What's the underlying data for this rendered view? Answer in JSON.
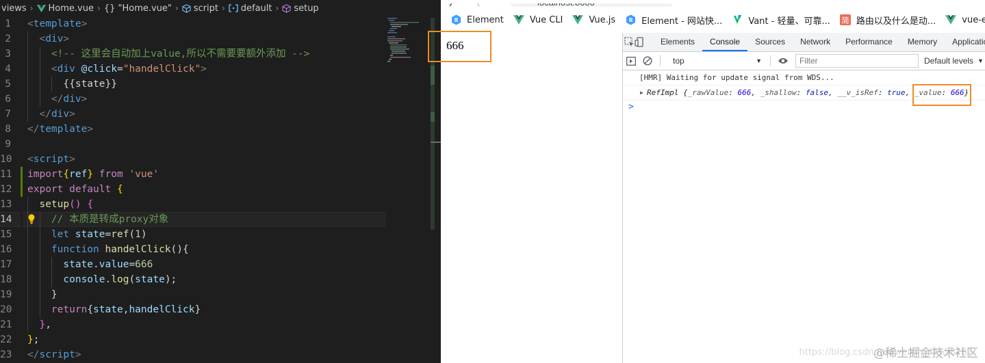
{
  "editor": {
    "breadcrumb": [
      "views",
      "Home.vue",
      "{} \"Home.vue\"",
      "script",
      "default",
      "setup"
    ],
    "lines": [
      {
        "n": "1",
        "tokens": [
          [
            "<",
            "t-punc"
          ],
          [
            "template",
            "t-tag"
          ],
          [
            ">",
            "t-punc"
          ]
        ]
      },
      {
        "n": "2",
        "tokens": [
          [
            "  ",
            ""
          ],
          [
            "<",
            "t-punc"
          ],
          [
            "div",
            "t-tag"
          ],
          [
            ">",
            "t-punc"
          ]
        ]
      },
      {
        "n": "3",
        "tokens": [
          [
            "    ",
            ""
          ],
          [
            "<!-- 这里会自动加上value,所以不需要要额外添加 -->",
            "t-com"
          ]
        ]
      },
      {
        "n": "4",
        "tokens": [
          [
            "    ",
            ""
          ],
          [
            "<",
            "t-punc"
          ],
          [
            "div",
            "t-tag"
          ],
          [
            " ",
            ""
          ],
          [
            "@click",
            "t-attr"
          ],
          [
            "=",
            "t-white"
          ],
          [
            "\"handelClick\"",
            "t-str"
          ],
          [
            ">",
            "t-punc"
          ]
        ]
      },
      {
        "n": "5",
        "tokens": [
          [
            "      ",
            ""
          ],
          [
            "{{state}}",
            "t-white"
          ]
        ]
      },
      {
        "n": "6",
        "tokens": [
          [
            "    ",
            ""
          ],
          [
            "</",
            "t-punc"
          ],
          [
            "div",
            "t-tag"
          ],
          [
            ">",
            "t-punc"
          ]
        ]
      },
      {
        "n": "7",
        "tokens": [
          [
            "  ",
            ""
          ],
          [
            "</",
            "t-punc"
          ],
          [
            "div",
            "t-tag"
          ],
          [
            ">",
            "t-punc"
          ]
        ]
      },
      {
        "n": "8",
        "tokens": [
          [
            "</",
            "t-punc"
          ],
          [
            "template",
            "t-tag"
          ],
          [
            ">",
            "t-punc"
          ]
        ]
      },
      {
        "n": "9",
        "tokens": []
      },
      {
        "n": "10",
        "tokens": [
          [
            "<",
            "t-punc"
          ],
          [
            "script",
            "t-tag"
          ],
          [
            ">",
            "t-punc"
          ]
        ]
      },
      {
        "n": "11",
        "tokens": [
          [
            "import",
            "t-kw"
          ],
          [
            "{",
            "t-br1"
          ],
          [
            "ref",
            "t-var"
          ],
          [
            "}",
            "t-br1"
          ],
          [
            " from ",
            "t-kw"
          ],
          [
            "'vue'",
            "t-str"
          ]
        ]
      },
      {
        "n": "12",
        "tokens": [
          [
            "export default ",
            "t-kw"
          ],
          [
            "{",
            "t-br1"
          ]
        ]
      },
      {
        "n": "13",
        "tokens": [
          [
            "  ",
            ""
          ],
          [
            "setup",
            "t-fn"
          ],
          [
            "()",
            "t-br2"
          ],
          [
            " ",
            ""
          ],
          [
            "{",
            "t-br2"
          ]
        ]
      },
      {
        "n": "14",
        "tokens": [
          [
            "    ",
            ""
          ],
          [
            "// 本质是转成proxy对象",
            "t-com"
          ]
        ]
      },
      {
        "n": "15",
        "tokens": [
          [
            "    ",
            ""
          ],
          [
            "let ",
            "t-blue"
          ],
          [
            "state",
            "t-var"
          ],
          [
            "=",
            "t-white"
          ],
          [
            "ref",
            "t-fn"
          ],
          [
            "(",
            "t-white"
          ],
          [
            "1",
            "t-num"
          ],
          [
            ")",
            "t-white"
          ]
        ]
      },
      {
        "n": "16",
        "tokens": [
          [
            "    ",
            ""
          ],
          [
            "function ",
            "t-blue"
          ],
          [
            "handelClick",
            "t-fn"
          ],
          [
            "(){",
            "t-white"
          ]
        ]
      },
      {
        "n": "17",
        "tokens": [
          [
            "      ",
            ""
          ],
          [
            "state",
            "t-var"
          ],
          [
            ".",
            "t-white"
          ],
          [
            "value",
            "t-var"
          ],
          [
            "=",
            "t-white"
          ],
          [
            "666",
            "t-num"
          ]
        ]
      },
      {
        "n": "18",
        "tokens": [
          [
            "      ",
            ""
          ],
          [
            "console",
            "t-var"
          ],
          [
            ".",
            "t-white"
          ],
          [
            "log",
            "t-fn"
          ],
          [
            "(",
            "t-white"
          ],
          [
            "state",
            "t-var"
          ],
          [
            ");",
            "t-white"
          ]
        ]
      },
      {
        "n": "19",
        "tokens": [
          [
            "    ",
            ""
          ],
          [
            "}",
            "t-white"
          ]
        ]
      },
      {
        "n": "20",
        "tokens": [
          [
            "    ",
            ""
          ],
          [
            "return",
            "t-kw"
          ],
          [
            "{",
            "t-white"
          ],
          [
            "state",
            "t-var"
          ],
          [
            ",",
            "t-white"
          ],
          [
            "handelClick",
            "t-var"
          ],
          [
            "}",
            "t-white"
          ]
        ]
      },
      {
        "n": "21",
        "tokens": [
          [
            "  ",
            ""
          ],
          [
            "}",
            "t-br2"
          ],
          [
            ",",
            "t-white"
          ]
        ]
      },
      {
        "n": "22",
        "tokens": [
          [
            "}",
            "t-br1"
          ],
          [
            ";",
            "t-white"
          ]
        ]
      },
      {
        "n": "23",
        "tokens": [
          [
            "</",
            "t-punc"
          ],
          [
            "script",
            "t-tag"
          ],
          [
            ">",
            "t-punc"
          ]
        ]
      }
    ]
  },
  "browser": {
    "bookmarks": [
      {
        "label": "Element",
        "icon": "element-icon"
      },
      {
        "label": "Vue CLI",
        "icon": "vue-icon"
      },
      {
        "label": "Vue.js",
        "icon": "vue-icon"
      },
      {
        "label": "Element - 网站快...",
        "icon": "element-icon"
      },
      {
        "label": "Vant - 轻量、可靠...",
        "icon": "vant-icon"
      },
      {
        "label": "路由以及什么是动...",
        "icon": "jianshu-icon"
      },
      {
        "label": "vue-eler",
        "icon": "vue-icon"
      }
    ],
    "page_text": "666"
  },
  "devtools": {
    "tabs": [
      "Elements",
      "Console",
      "Sources",
      "Network",
      "Performance",
      "Memory",
      "Application"
    ],
    "selected_tab": "Console",
    "context": "top",
    "filter_placeholder": "Filter",
    "levels": "Default levels",
    "logs": {
      "hmr": "[HMR] Waiting for update signal from WDS...",
      "obj_class": "RefImpl",
      "rawValue_key": "_rawValue",
      "rawValue": "666",
      "shallow_key": "_shallow",
      "shallow": "false",
      "isRef_key": "__v_isRef",
      "isRef": "true",
      "value_key": "_value",
      "value": "666"
    },
    "prompt": ">"
  },
  "watermark": "@稀土掘金技术社区",
  "watermark_url": "https://blog.csdn.net/weixin_41658287",
  "colors": {
    "accent": "#1a73e8",
    "highlight_box": "#f08a24",
    "editor_bg": "#1e1e1e"
  }
}
